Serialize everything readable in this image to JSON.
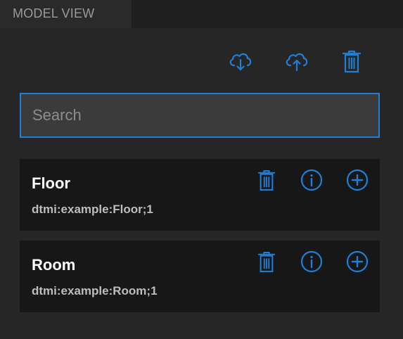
{
  "tab": {
    "title": "MODEL VIEW"
  },
  "toolbar": {
    "download_icon": "cloud-download-icon",
    "upload_icon": "cloud-upload-icon",
    "delete_icon": "trash-icon"
  },
  "search": {
    "placeholder": "Search",
    "value": ""
  },
  "models": [
    {
      "name": "Floor",
      "id": "dtmi:example:Floor;1"
    },
    {
      "name": "Room",
      "id": "dtmi:example:Room;1"
    }
  ],
  "colors": {
    "accent": "#1f7ed6",
    "background": "#262626",
    "card": "#171717"
  }
}
